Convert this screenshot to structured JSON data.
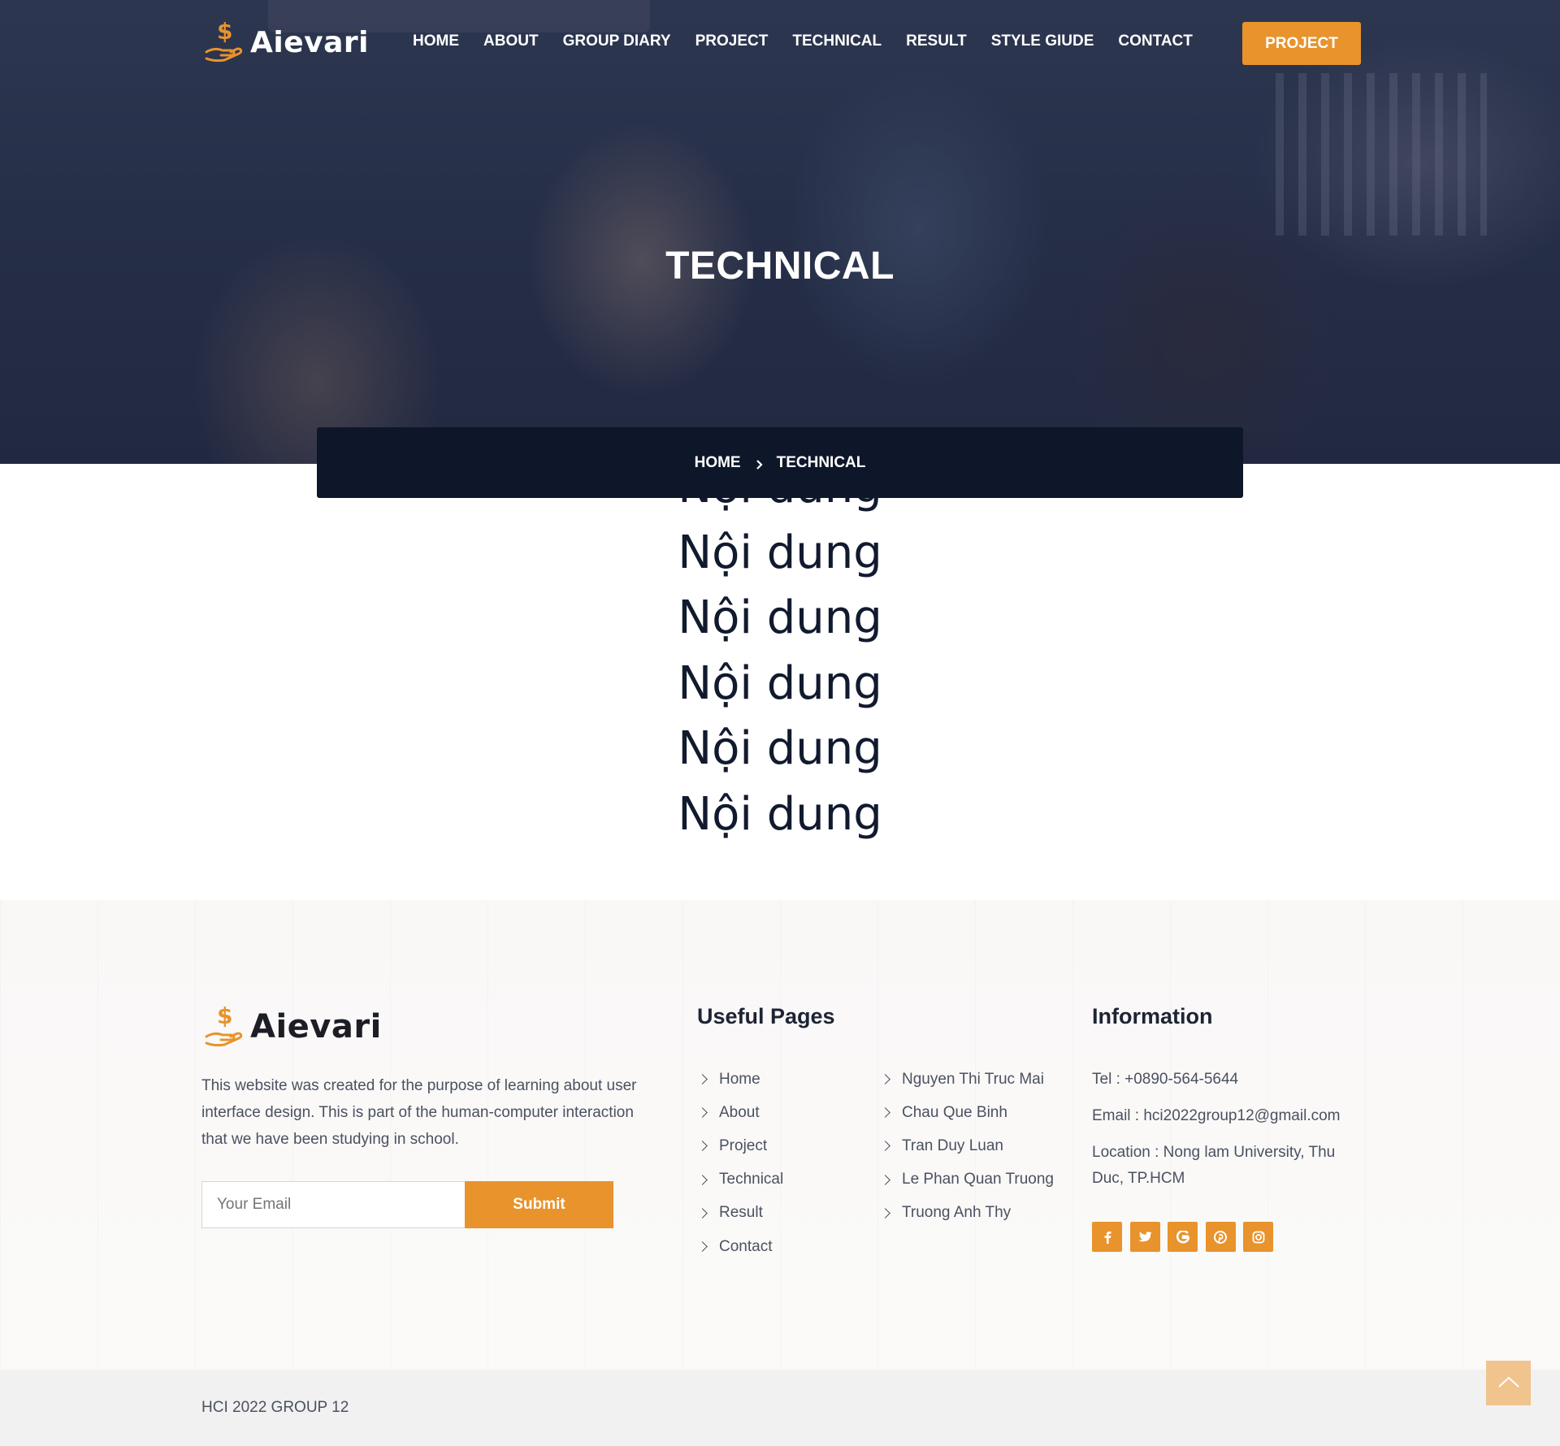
{
  "header": {
    "logo_text": "Aievari",
    "menu": [
      "HOME",
      "ABOUT",
      "GROUP DIARY",
      "PROJECT",
      "TECHNICAL",
      "RESULT",
      "STYLE GIUDE",
      "CONTACT"
    ],
    "cta_label": "PROJECT"
  },
  "hero": {
    "title": "TECHNICAL",
    "breadcrumb": {
      "home": "HOME",
      "current": "TECHNICAL"
    }
  },
  "content": {
    "lines": [
      "Nội dung",
      "Nội dung",
      "Nội dung",
      "Nội dung",
      "Nội dung",
      "Nội dung"
    ]
  },
  "footer": {
    "logo_text": "Aievari",
    "description": "This website was created for the purpose of learning about user interface design. This is part of the human-computer interaction that we have been studying in school.",
    "email_placeholder": "Your Email",
    "submit_label": "Submit",
    "useful_pages_title": "Useful Pages",
    "pages": [
      "Home",
      "About",
      "Project",
      "Technical",
      "Result",
      "Contact"
    ],
    "members": [
      "Nguyen Thi Truc Mai",
      "Chau Que Binh",
      "Tran Duy Luan",
      "Le Phan Quan Truong",
      "Truong Anh Thy"
    ],
    "information_title": "Information",
    "tel": "Tel : +0890-564-5644",
    "email": "Email : hci2022group12@gmail.com",
    "location": "Location : Nong lam University, Thu Duc, TP.HCM",
    "socials": [
      "facebook-icon",
      "twitter-icon",
      "google-icon",
      "pinterest-icon",
      "instagram-icon"
    ],
    "copyright": "HCI 2022 GROUP 12"
  },
  "colors": {
    "accent": "#e8932c",
    "breadcrumb_bg": "#0e1729",
    "text_dark": "#111a2e"
  }
}
